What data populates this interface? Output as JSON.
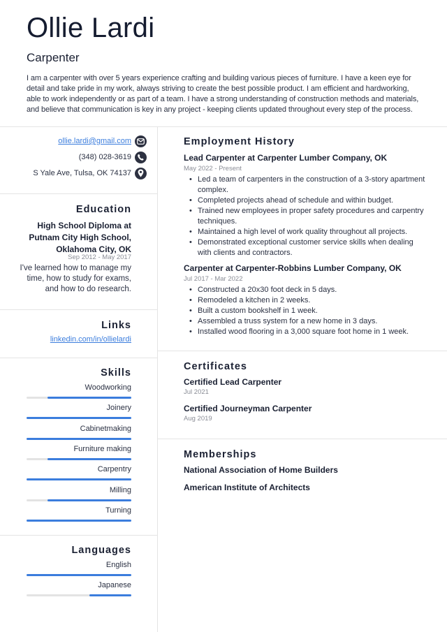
{
  "header": {
    "name": "Ollie Lardi",
    "job_title": "Carpenter",
    "summary": "I am a carpenter with over 5 years experience crafting and building various pieces of furniture. I have a keen eye for detail and take pride in my work, always striving to create the best possible product. I am efficient and hardworking, able to work independently or as part of a team. I have a strong understanding of construction methods and materials, and believe that communication is key in any project - keeping clients updated throughout every step of the process."
  },
  "contact": {
    "email": "ollie.lardi@gmail.com",
    "email_icon": "envelope-icon",
    "phone": "(348) 028-3619",
    "phone_icon": "phone-icon",
    "address": "S Yale Ave, Tulsa, OK 74137",
    "address_icon": "map-pin-icon"
  },
  "education": {
    "title": "Education",
    "degree": "High School Diploma at Putnam City High School, Oklahoma City, OK",
    "dates": "Sep 2012 - May 2017",
    "description": "I've learned how to manage my time, how to study for exams, and how to do research."
  },
  "links": {
    "title": "Links",
    "items": [
      {
        "label": "linkedin.com/in/ollielardi"
      }
    ]
  },
  "skills": {
    "title": "Skills",
    "items": [
      {
        "name": "Woodworking",
        "level": 0.8
      },
      {
        "name": "Joinery",
        "level": 1.0
      },
      {
        "name": "Cabinetmaking",
        "level": 1.0
      },
      {
        "name": "Furniture making",
        "level": 0.8
      },
      {
        "name": "Carpentry",
        "level": 1.0
      },
      {
        "name": "Milling",
        "level": 0.8
      },
      {
        "name": "Turning",
        "level": 1.0
      }
    ]
  },
  "languages": {
    "title": "Languages",
    "items": [
      {
        "name": "English",
        "level": 1.0
      },
      {
        "name": "Japanese",
        "level": 0.4
      }
    ]
  },
  "employment": {
    "title": "Employment History",
    "jobs": [
      {
        "title": "Lead Carpenter at Carpenter Lumber Company, OK",
        "dates": "May 2022 - Present",
        "bullets": [
          "Led a team of carpenters in the construction of a 3-story apartment complex.",
          "Completed projects ahead of schedule and within budget.",
          "Trained new employees in proper safety procedures and carpentry techniques.",
          "Maintained a high level of work quality throughout all projects.",
          "Demonstrated exceptional customer service skills when dealing with clients and contractors."
        ]
      },
      {
        "title": "Carpenter at Carpenter-Robbins Lumber Company, OK",
        "dates": "Jul 2017 - Mar 2022",
        "bullets": [
          "Constructed a 20x30 foot deck in 5 days.",
          "Remodeled a kitchen in 2 weeks.",
          "Built a custom bookshelf in 1 week.",
          "Assembled a truss system for a new home in 3 days.",
          "Installed wood flooring in a 3,000 square foot home in 1 week."
        ]
      }
    ]
  },
  "certificates": {
    "title": "Certificates",
    "items": [
      {
        "name": "Certified Lead Carpenter",
        "date": "Jul 2021"
      },
      {
        "name": "Certified Journeyman Carpenter",
        "date": "Aug 2019"
      }
    ]
  },
  "memberships": {
    "title": "Memberships",
    "items": [
      {
        "name": "National Association of Home Builders"
      },
      {
        "name": "American Institute of Architects"
      }
    ]
  },
  "colors": {
    "accent": "#3b7ddd",
    "text": "#1b2133",
    "muted": "#8a8d96",
    "track": "#e3e3e3",
    "icon_bg": "#2d3141"
  }
}
